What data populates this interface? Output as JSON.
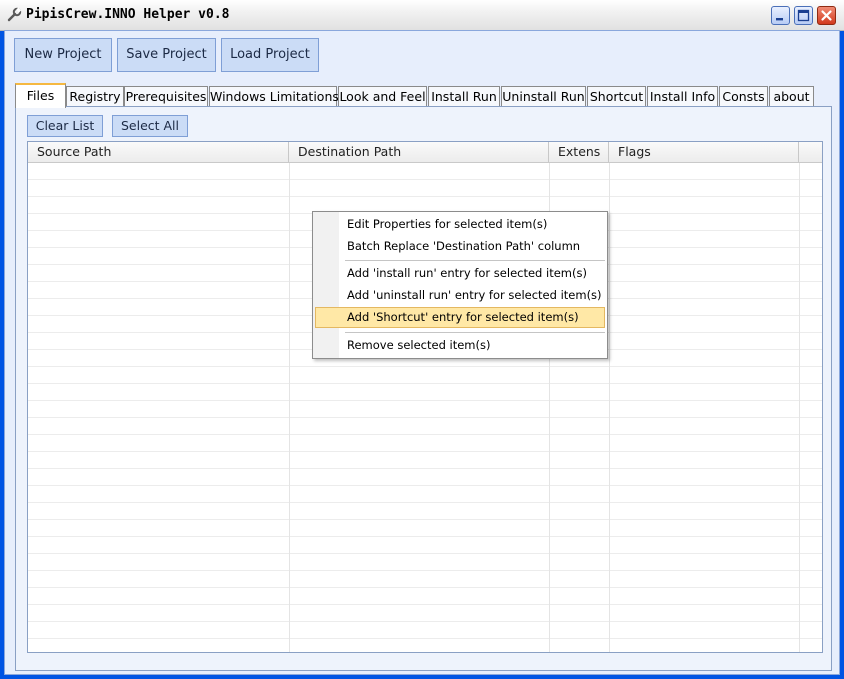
{
  "window": {
    "title": "PipisCrew.INNO Helper v0.8",
    "icon": "wrench-icon"
  },
  "toolbar": {
    "new_label": "New Project",
    "save_label": "Save Project",
    "load_label": "Load Project"
  },
  "tabs": [
    {
      "label": "Files",
      "active": true
    },
    {
      "label": "Registry"
    },
    {
      "label": "Prerequisites"
    },
    {
      "label": "Windows Limitations"
    },
    {
      "label": "Look and Feel"
    },
    {
      "label": "Install Run"
    },
    {
      "label": "Uninstall Run"
    },
    {
      "label": "Shortcut"
    },
    {
      "label": "Install Info"
    },
    {
      "label": "Consts"
    },
    {
      "label": "about"
    }
  ],
  "files_panel": {
    "clear_label": "Clear List",
    "select_all_label": "Select All",
    "columns": [
      "Source Path",
      "Destination Path",
      "Extens",
      "Flags"
    ]
  },
  "context_menu": {
    "items": [
      "Edit Properties for selected item(s)",
      "Batch Replace 'Destination Path' column",
      "Add 'install run' entry for selected item(s)",
      "Add 'uninstall run' entry for selected item(s)",
      "Add 'Shortcut' entry for selected item(s)",
      "Remove selected item(s)"
    ],
    "highlighted_index": 4
  },
  "colors": {
    "window_frame": "#0054e3",
    "client_bg": "#e7eefc",
    "button_bg": "#cbdcf6",
    "tab_active_accent": "#f5b841",
    "menu_highlight": "#ffe8a6"
  }
}
